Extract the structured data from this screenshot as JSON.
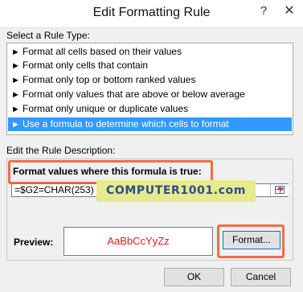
{
  "window": {
    "title": "Edit Formatting Rule",
    "help_label": "?",
    "close_label": "✕"
  },
  "rule_type": {
    "label_prefix": "Select a Rule Type",
    "rules": [
      {
        "label": "Format all cells based on their values",
        "selected": false
      },
      {
        "label": "Format only cells that contain",
        "selected": false
      },
      {
        "label": "Format only top or bottom ranked values",
        "selected": false
      },
      {
        "label": "Format only values that are above or below average",
        "selected": false
      },
      {
        "label": "Format only unique or duplicate values",
        "selected": false
      },
      {
        "label": "Use a formula to determine which cells to format",
        "selected": true
      }
    ],
    "arrow_glyph": "►"
  },
  "description": {
    "label": "Edit the Rule Description:",
    "formula_label": "Format values where this formula is true:",
    "formula_value": "=$G2=CHAR(253)",
    "watermark": "COMPUTER1001.com",
    "preview_label": "Preview:",
    "preview_text": "AaBbCcYyZz",
    "format_button": "Format..."
  },
  "footer": {
    "ok_label": "OK",
    "cancel_label": "Cancel"
  },
  "colors": {
    "selection": "#3399ff",
    "highlight_border": "#ef6e46",
    "preview_text": "#e21b1b",
    "watermark_bg": "#e7ea8e"
  }
}
